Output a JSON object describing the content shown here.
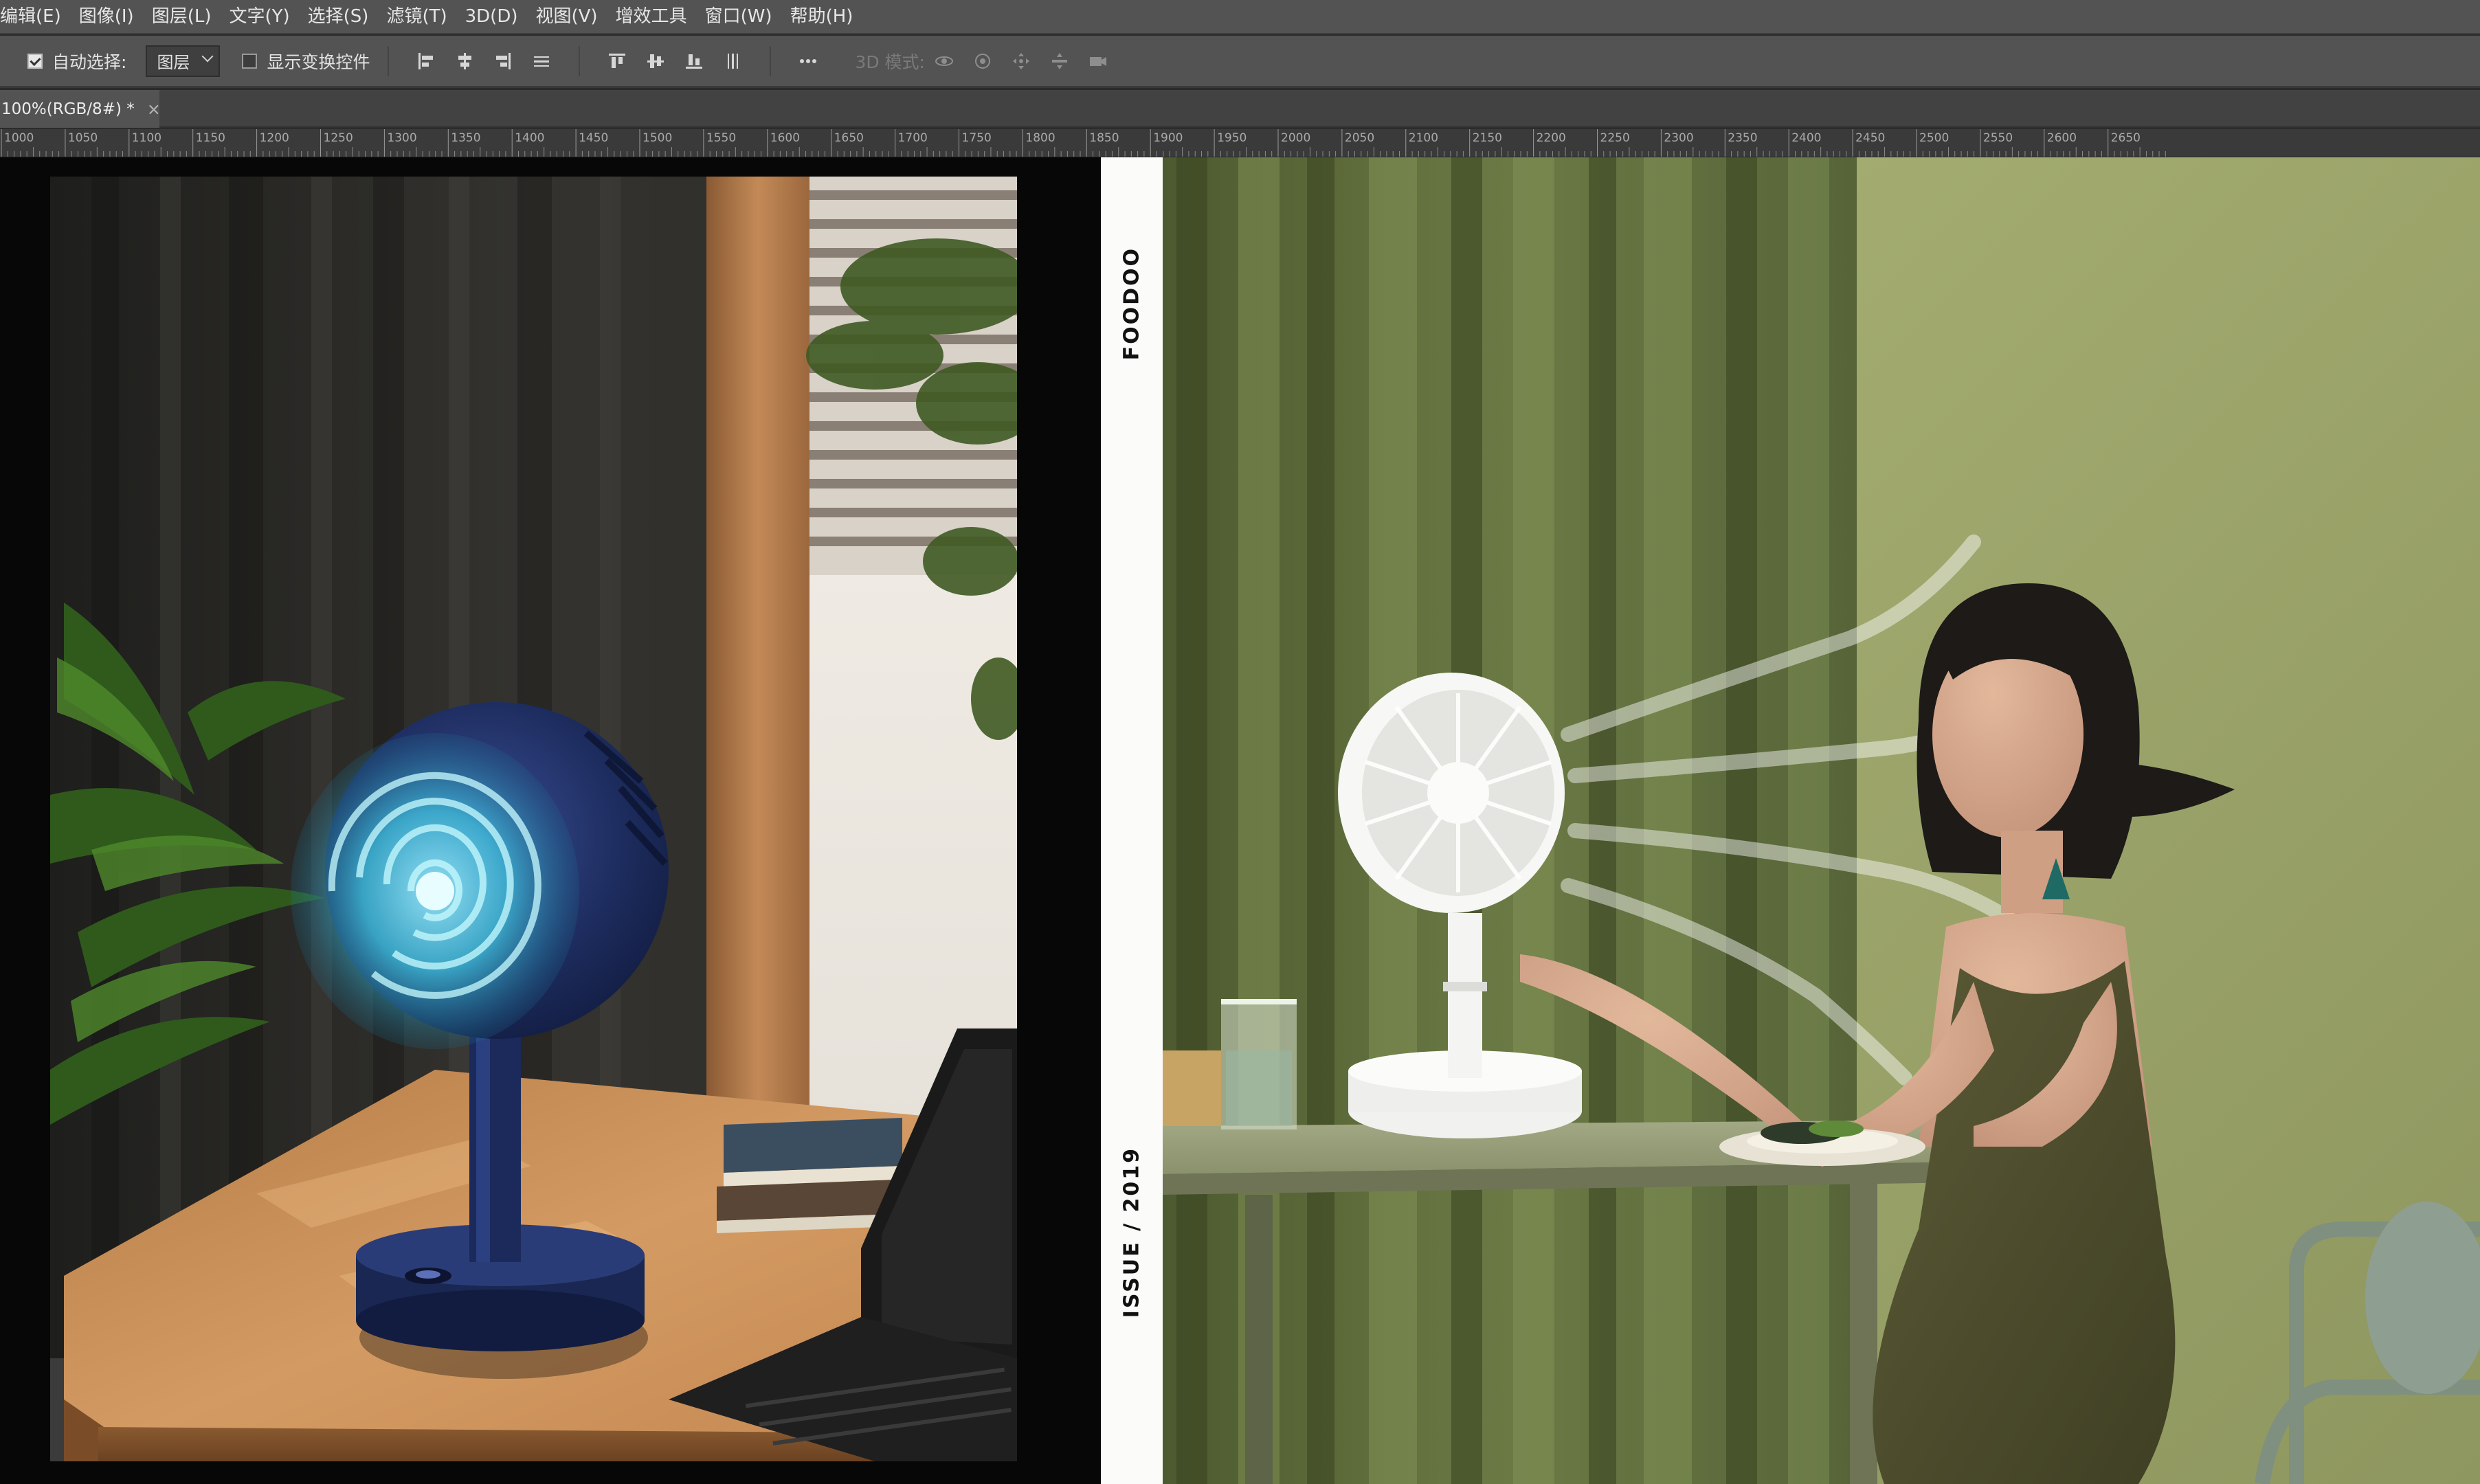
{
  "menubar": {
    "items": [
      "编辑(E)",
      "图像(I)",
      "图层(L)",
      "文字(Y)",
      "选择(S)",
      "滤镜(T)",
      "3D(D)",
      "视图(V)",
      "增效工具",
      "窗口(W)",
      "帮助(H)"
    ]
  },
  "options_bar": {
    "auto_select_label": "自动选择:",
    "auto_select_checked": true,
    "auto_select_target": "图层",
    "show_transform_label": "显示变换控件",
    "show_transform_checked": false,
    "mode_3d_label": "3D 模式:",
    "align_icons": [
      "align-left-icon",
      "align-h-center-icon",
      "align-right-icon",
      "distribute-h-icon",
      "align-top-icon",
      "align-v-center-icon",
      "align-bottom-icon",
      "distribute-v-icon"
    ],
    "more_icon": "more-dots-icon",
    "mode_3d_icons": [
      "orbit-icon",
      "roll-icon",
      "pan-icon",
      "slide-icon",
      "scale-camera-icon"
    ]
  },
  "document_tab": {
    "title": "100%(RGB/8#) *",
    "close": "×"
  },
  "ruler": {
    "labels": [
      "1000",
      "1050",
      "1100",
      "1150",
      "1200",
      "1250",
      "1300",
      "1350",
      "1400",
      "1450",
      "1500",
      "1550",
      "1600",
      "1650",
      "1700",
      "1750",
      "1800",
      "1850",
      "1900",
      "1950",
      "2000",
      "2050",
      "2100",
      "2150",
      "2200",
      "2250",
      "2300",
      "2350",
      "2400",
      "2450",
      "2500",
      "2550",
      "2600",
      "2650"
    ]
  },
  "canvas": {
    "magazine_strip_top": "FOODOO",
    "magazine_strip_issue": "ISSUE / 2019"
  },
  "colors": {
    "ui_panel": "#535353",
    "ui_dark": "#424242",
    "canvas_bg": "#070707",
    "curtain_green": "#5a6a3c",
    "wall_green": "#9aa46a",
    "fan_navy": "#1d2c5e",
    "fan_glow": "#3fc0dc",
    "desk_wood": "#c8915b"
  }
}
